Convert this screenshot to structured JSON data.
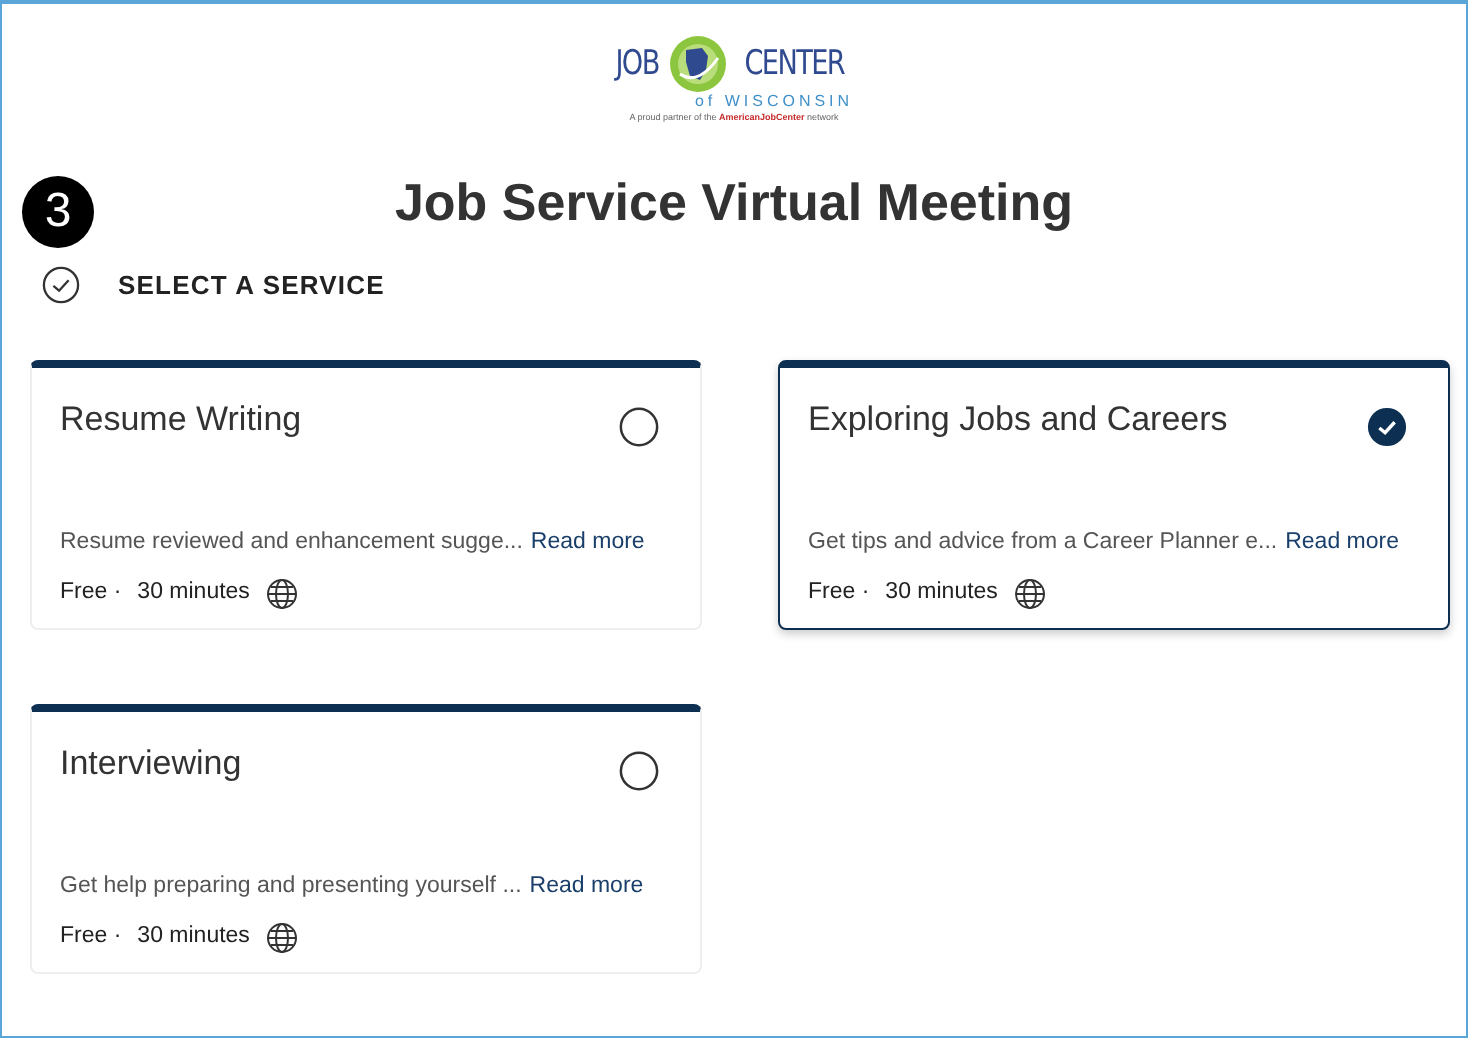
{
  "logo": {
    "word_left": "JOB",
    "word_right": "CENTER",
    "subtitle": "of WISCONSIN",
    "tagline_start": "A proud partner of the ",
    "tagline_brand": "AmericanJobCenter",
    "tagline_end": " network"
  },
  "step": "3",
  "title": "Job Service Virtual Meeting",
  "section": {
    "label": "SELECT A SERVICE"
  },
  "services": [
    {
      "name": "Resume Writing",
      "selected": false,
      "description": "Resume reviewed and enhancement sugge...",
      "link": "Read more",
      "price": "Free ·",
      "duration": "30 minutes"
    },
    {
      "name": "Exploring Jobs and Careers",
      "selected": true,
      "description": "Get tips and advice from a Career Planner e...",
      "link": "Read more",
      "price": "Free ·",
      "duration": "30 minutes"
    },
    {
      "name": "Interviewing",
      "selected": false,
      "description": "Get help preparing and presenting yourself ...",
      "link": "Read more",
      "price": "Free ·",
      "duration": "30 minutes"
    }
  ]
}
